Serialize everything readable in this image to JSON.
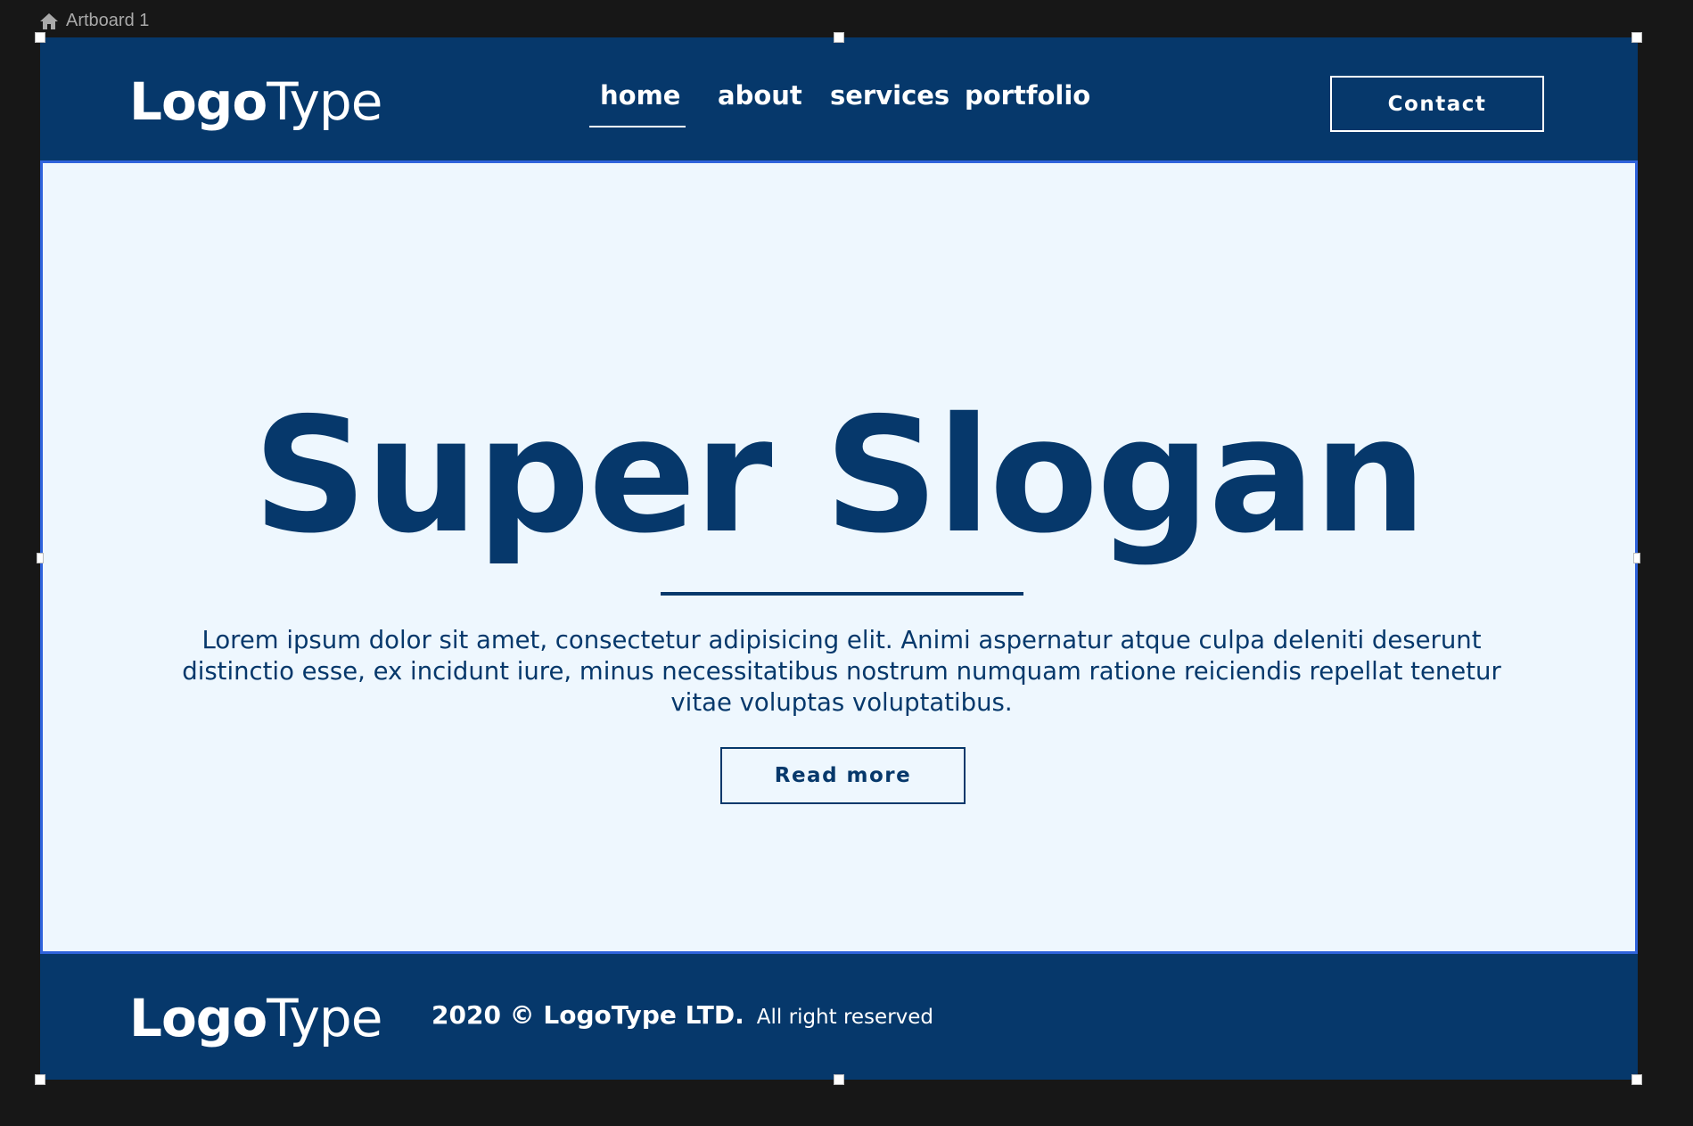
{
  "artboard": {
    "label": "Artboard 1",
    "icon": "home-icon"
  },
  "header": {
    "logo_bold": "Logo",
    "logo_light": "Type",
    "nav": {
      "home": "home",
      "about": "about",
      "services": "services",
      "portfolio": "portfolio"
    },
    "contact_label": "Contact"
  },
  "hero": {
    "slogan": "Super Slogan",
    "body": "Lorem ipsum dolor sit amet, consectetur adipisicing elit. Animi aspernatur atque culpa deleniti deserunt distinctio esse, ex incidunt iure, minus necessitatibus nostrum numquam ratione reiciendis repellat tenetur vitae voluptas voluptatibus.",
    "read_more_label": "Read more"
  },
  "footer": {
    "logo_bold": "Logo",
    "logo_light": "Type",
    "copyright": "2020 © LogoType LTD.",
    "rights": "All right reserved"
  },
  "colors": {
    "brand_navy": "#06386b",
    "hero_background": "#eef7fe",
    "selection_blue": "#2f63dc",
    "canvas_background": "#171717"
  }
}
